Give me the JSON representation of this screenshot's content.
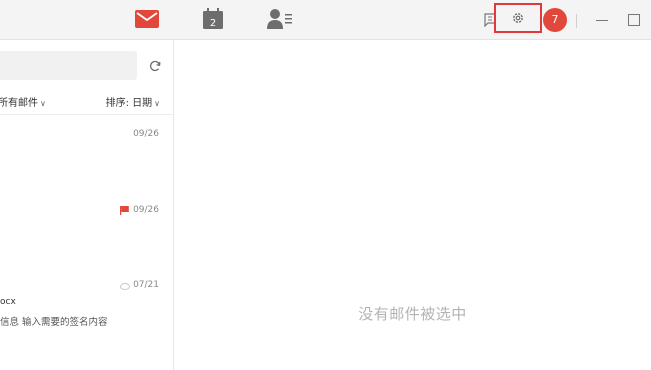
{
  "toolbar": {
    "icons": [
      "mail-icon",
      "calendar-icon",
      "contacts-icon",
      "chat-icon",
      "gear-icon"
    ],
    "calendar_day": "2",
    "notification_count": "7",
    "accent_color": "#e2473b"
  },
  "list": {
    "filter_label": "所有邮件",
    "sort_label": "排序: 日期",
    "items": [
      {
        "date": "09/26",
        "flagged": false
      },
      {
        "date": "09/26",
        "flagged": true
      },
      {
        "date": "07/21",
        "attachment": "ocx",
        "preview": "信息 输入需要的签名内容"
      }
    ]
  },
  "reading_pane": {
    "empty_text": "没有邮件被选中"
  }
}
